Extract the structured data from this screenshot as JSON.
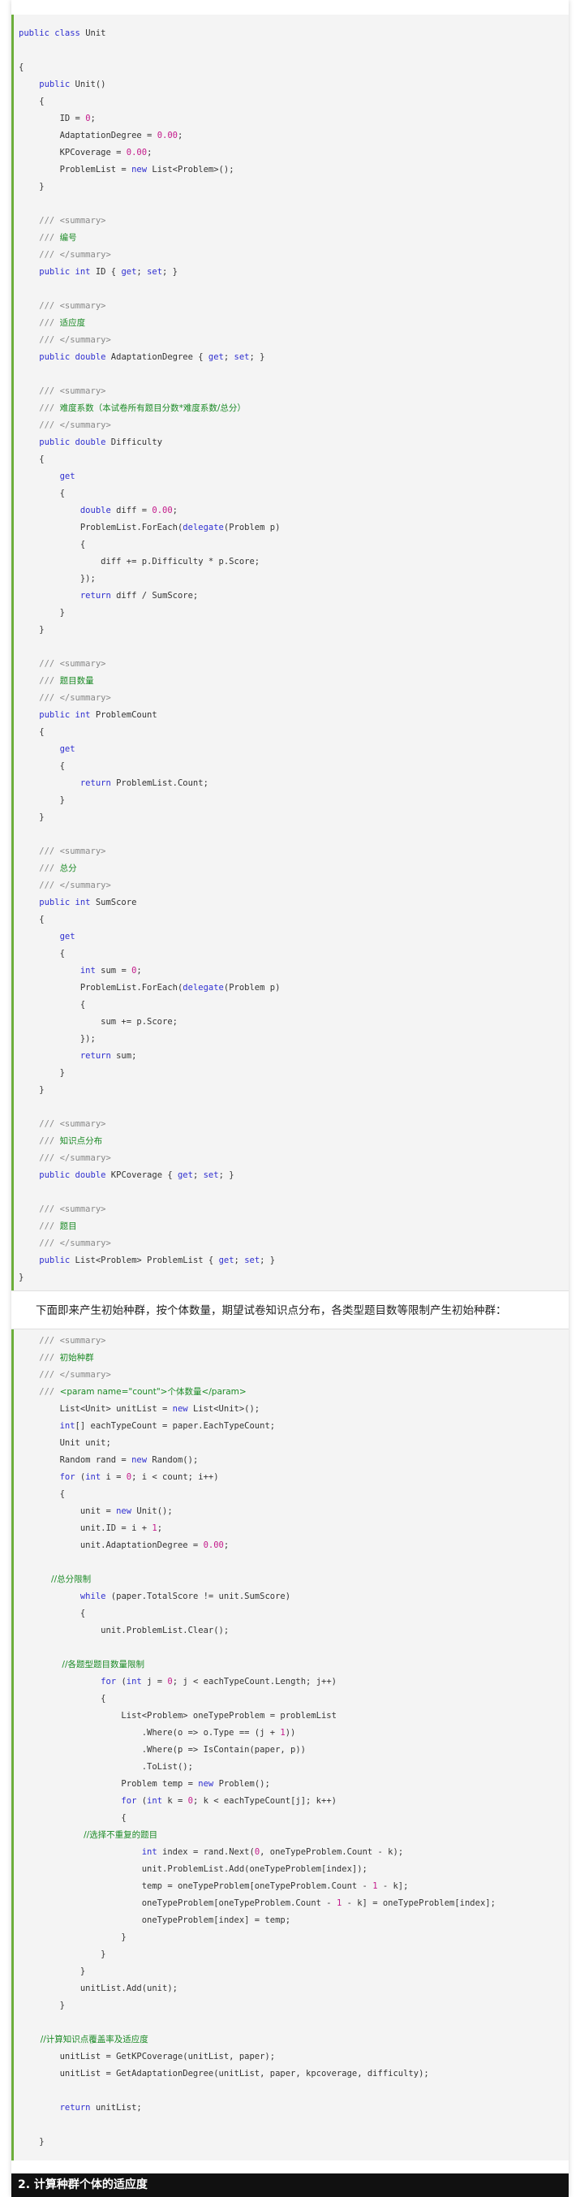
{
  "code_block_1": {
    "lines": [
      [
        {
          "t": "public class ",
          "c": "kw"
        },
        {
          "t": "Unit",
          "c": ""
        }
      ],
      [],
      [
        {
          "t": "{",
          "c": ""
        }
      ],
      [
        {
          "t": "    public ",
          "c": "kw"
        },
        {
          "t": "Unit()",
          "c": ""
        }
      ],
      [
        {
          "t": "    {",
          "c": ""
        }
      ],
      [
        {
          "t": "        ID = ",
          "c": ""
        },
        {
          "t": "0",
          "c": "num"
        },
        {
          "t": ";",
          "c": ""
        }
      ],
      [
        {
          "t": "        AdaptationDegree = ",
          "c": ""
        },
        {
          "t": "0.00",
          "c": "num"
        },
        {
          "t": ";",
          "c": ""
        }
      ],
      [
        {
          "t": "        KPCoverage = ",
          "c": ""
        },
        {
          "t": "0.00",
          "c": "num"
        },
        {
          "t": ";",
          "c": ""
        }
      ],
      [
        {
          "t": "        ProblemList = ",
          "c": ""
        },
        {
          "t": "new ",
          "c": "kw"
        },
        {
          "t": "List<Problem>();",
          "c": ""
        }
      ],
      [
        {
          "t": "    }",
          "c": ""
        }
      ],
      [],
      [
        {
          "t": "    /// <summary>",
          "c": "cm"
        }
      ],
      [
        {
          "t": "    /// ",
          "c": "cm"
        },
        {
          "t": "编号",
          "c": "cmc"
        }
      ],
      [
        {
          "t": "    /// </summary>",
          "c": "cm"
        }
      ],
      [
        {
          "t": "    public int ",
          "c": "kw"
        },
        {
          "t": "ID { ",
          "c": ""
        },
        {
          "t": "get",
          "c": "kw"
        },
        {
          "t": "; ",
          "c": ""
        },
        {
          "t": "set",
          "c": "kw"
        },
        {
          "t": "; }",
          "c": ""
        }
      ],
      [],
      [
        {
          "t": "    /// <summary>",
          "c": "cm"
        }
      ],
      [
        {
          "t": "    /// ",
          "c": "cm"
        },
        {
          "t": "适应度",
          "c": "cmc"
        }
      ],
      [
        {
          "t": "    /// </summary>",
          "c": "cm"
        }
      ],
      [
        {
          "t": "    public double ",
          "c": "kw"
        },
        {
          "t": "AdaptationDegree { ",
          "c": ""
        },
        {
          "t": "get",
          "c": "kw"
        },
        {
          "t": "; ",
          "c": ""
        },
        {
          "t": "set",
          "c": "kw"
        },
        {
          "t": "; }",
          "c": ""
        }
      ],
      [],
      [
        {
          "t": "    /// <summary>",
          "c": "cm"
        }
      ],
      [
        {
          "t": "    /// ",
          "c": "cm"
        },
        {
          "t": "难度系数（本试卷所有题目分数*难度系数/总分）",
          "c": "cmc"
        }
      ],
      [
        {
          "t": "    /// </summary>",
          "c": "cm"
        }
      ],
      [
        {
          "t": "    public double ",
          "c": "kw"
        },
        {
          "t": "Difficulty",
          "c": ""
        }
      ],
      [
        {
          "t": "    {",
          "c": ""
        }
      ],
      [
        {
          "t": "        get",
          "c": "kw"
        }
      ],
      [
        {
          "t": "        {",
          "c": ""
        }
      ],
      [
        {
          "t": "            double ",
          "c": "kw"
        },
        {
          "t": "diff = ",
          "c": ""
        },
        {
          "t": "0.00",
          "c": "num"
        },
        {
          "t": ";",
          "c": ""
        }
      ],
      [
        {
          "t": "            ProblemList.ForEach(",
          "c": ""
        },
        {
          "t": "delegate",
          "c": "kw"
        },
        {
          "t": "(Problem p)",
          "c": ""
        }
      ],
      [
        {
          "t": "            {",
          "c": ""
        }
      ],
      [
        {
          "t": "                diff += p.Difficulty * p.Score;",
          "c": ""
        }
      ],
      [
        {
          "t": "            });",
          "c": ""
        }
      ],
      [
        {
          "t": "            return ",
          "c": "kw"
        },
        {
          "t": "diff / SumScore;",
          "c": ""
        }
      ],
      [
        {
          "t": "        }",
          "c": ""
        }
      ],
      [
        {
          "t": "    }",
          "c": ""
        }
      ],
      [],
      [
        {
          "t": "    /// <summary>",
          "c": "cm"
        }
      ],
      [
        {
          "t": "    /// ",
          "c": "cm"
        },
        {
          "t": "题目数量",
          "c": "cmc"
        }
      ],
      [
        {
          "t": "    /// </summary>",
          "c": "cm"
        }
      ],
      [
        {
          "t": "    public int ",
          "c": "kw"
        },
        {
          "t": "ProblemCount",
          "c": ""
        }
      ],
      [
        {
          "t": "    {",
          "c": ""
        }
      ],
      [
        {
          "t": "        get",
          "c": "kw"
        }
      ],
      [
        {
          "t": "        {",
          "c": ""
        }
      ],
      [
        {
          "t": "            return ",
          "c": "kw"
        },
        {
          "t": "ProblemList.Count;",
          "c": ""
        }
      ],
      [
        {
          "t": "        }",
          "c": ""
        }
      ],
      [
        {
          "t": "    }",
          "c": ""
        }
      ],
      [],
      [
        {
          "t": "    /// <summary>",
          "c": "cm"
        }
      ],
      [
        {
          "t": "    /// ",
          "c": "cm"
        },
        {
          "t": "总分",
          "c": "cmc"
        }
      ],
      [
        {
          "t": "    /// </summary>",
          "c": "cm"
        }
      ],
      [
        {
          "t": "    public int ",
          "c": "kw"
        },
        {
          "t": "SumScore",
          "c": ""
        }
      ],
      [
        {
          "t": "    {",
          "c": ""
        }
      ],
      [
        {
          "t": "        get",
          "c": "kw"
        }
      ],
      [
        {
          "t": "        {",
          "c": ""
        }
      ],
      [
        {
          "t": "            int ",
          "c": "kw"
        },
        {
          "t": "sum = ",
          "c": ""
        },
        {
          "t": "0",
          "c": "num"
        },
        {
          "t": ";",
          "c": ""
        }
      ],
      [
        {
          "t": "            ProblemList.ForEach(",
          "c": ""
        },
        {
          "t": "delegate",
          "c": "kw"
        },
        {
          "t": "(Problem p)",
          "c": ""
        }
      ],
      [
        {
          "t": "            {",
          "c": ""
        }
      ],
      [
        {
          "t": "                sum += p.Score;",
          "c": ""
        }
      ],
      [
        {
          "t": "            });",
          "c": ""
        }
      ],
      [
        {
          "t": "            return ",
          "c": "kw"
        },
        {
          "t": "sum;",
          "c": ""
        }
      ],
      [
        {
          "t": "        }",
          "c": ""
        }
      ],
      [
        {
          "t": "    }",
          "c": ""
        }
      ],
      [],
      [
        {
          "t": "    /// <summary>",
          "c": "cm"
        }
      ],
      [
        {
          "t": "    /// ",
          "c": "cm"
        },
        {
          "t": "知识点分布",
          "c": "cmc"
        }
      ],
      [
        {
          "t": "    /// </summary>",
          "c": "cm"
        }
      ],
      [
        {
          "t": "    public double ",
          "c": "kw"
        },
        {
          "t": "KPCoverage { ",
          "c": ""
        },
        {
          "t": "get",
          "c": "kw"
        },
        {
          "t": "; ",
          "c": ""
        },
        {
          "t": "set",
          "c": "kw"
        },
        {
          "t": "; }",
          "c": ""
        }
      ],
      [],
      [
        {
          "t": "    /// <summary>",
          "c": "cm"
        }
      ],
      [
        {
          "t": "    /// ",
          "c": "cm"
        },
        {
          "t": "题目",
          "c": "cmc"
        }
      ],
      [
        {
          "t": "    /// </summary>",
          "c": "cm"
        }
      ],
      [
        {
          "t": "    public ",
          "c": "kw"
        },
        {
          "t": "List<Problem> ProblemList { ",
          "c": ""
        },
        {
          "t": "get",
          "c": "kw"
        },
        {
          "t": "; ",
          "c": ""
        },
        {
          "t": "set",
          "c": "kw"
        },
        {
          "t": "; }",
          "c": ""
        }
      ],
      [
        {
          "t": "}",
          "c": ""
        }
      ]
    ]
  },
  "paragraph": "下面即来产生初始种群，按个体数量，期望试卷知识点分布，各类型题目数等限制产生初始种群：",
  "code_block_2": {
    "lines": [
      [
        {
          "t": "    /// <summary>",
          "c": "cm"
        }
      ],
      [
        {
          "t": "    /// ",
          "c": "cm"
        },
        {
          "t": "初始种群",
          "c": "cmc"
        }
      ],
      [
        {
          "t": "    /// </summary>",
          "c": "cm"
        }
      ],
      [
        {
          "t": "    /// ",
          "c": "cm"
        },
        {
          "t": "<param name=\"count\">个体数量</param>",
          "c": "cmc"
        }
      ],
      [
        {
          "t": "        List<Unit> unitList = ",
          "c": ""
        },
        {
          "t": "new ",
          "c": "kw"
        },
        {
          "t": "List<Unit>();",
          "c": ""
        }
      ],
      [
        {
          "t": "        int",
          "c": "kw"
        },
        {
          "t": "[] eachTypeCount = paper.EachTypeCount;",
          "c": ""
        }
      ],
      [
        {
          "t": "        Unit unit;",
          "c": ""
        }
      ],
      [
        {
          "t": "        Random rand = ",
          "c": ""
        },
        {
          "t": "new ",
          "c": "kw"
        },
        {
          "t": "Random();",
          "c": ""
        }
      ],
      [
        {
          "t": "        for ",
          "c": "kw"
        },
        {
          "t": "(",
          "c": ""
        },
        {
          "t": "int ",
          "c": "kw"
        },
        {
          "t": "i = ",
          "c": ""
        },
        {
          "t": "0",
          "c": "num"
        },
        {
          "t": "; i < count; i++)",
          "c": ""
        }
      ],
      [
        {
          "t": "        {",
          "c": ""
        }
      ],
      [
        {
          "t": "            unit = ",
          "c": ""
        },
        {
          "t": "new ",
          "c": "kw"
        },
        {
          "t": "Unit();",
          "c": ""
        }
      ],
      [
        {
          "t": "            unit.ID = i + ",
          "c": ""
        },
        {
          "t": "1",
          "c": "num"
        },
        {
          "t": ";",
          "c": ""
        }
      ],
      [
        {
          "t": "            unit.AdaptationDegree = ",
          "c": ""
        },
        {
          "t": "0.00",
          "c": "num"
        },
        {
          "t": ";",
          "c": ""
        }
      ],
      [],
      [
        {
          "t": "            //总分限制",
          "c": "cmc"
        }
      ],
      [
        {
          "t": "            while ",
          "c": "kw"
        },
        {
          "t": "(paper.TotalScore != unit.SumScore)",
          "c": ""
        }
      ],
      [
        {
          "t": "            {",
          "c": ""
        }
      ],
      [
        {
          "t": "                unit.ProblemList.Clear();",
          "c": ""
        }
      ],
      [],
      [
        {
          "t": "                //各题型题目数量限制",
          "c": "cmc"
        }
      ],
      [
        {
          "t": "                for ",
          "c": "kw"
        },
        {
          "t": "(",
          "c": ""
        },
        {
          "t": "int ",
          "c": "kw"
        },
        {
          "t": "j = ",
          "c": ""
        },
        {
          "t": "0",
          "c": "num"
        },
        {
          "t": "; j < eachTypeCount.Length; j++)",
          "c": ""
        }
      ],
      [
        {
          "t": "                {",
          "c": ""
        }
      ],
      [
        {
          "t": "                    List<Problem> oneTypeProblem = problemList",
          "c": ""
        }
      ],
      [
        {
          "t": "                        .Where(o => o.Type == (j + ",
          "c": ""
        },
        {
          "t": "1",
          "c": "num"
        },
        {
          "t": "))",
          "c": ""
        }
      ],
      [
        {
          "t": "                        .Where(p => IsContain(paper, p))",
          "c": ""
        }
      ],
      [
        {
          "t": "                        .ToList();",
          "c": ""
        }
      ],
      [
        {
          "t": "                    Problem temp = ",
          "c": ""
        },
        {
          "t": "new ",
          "c": "kw"
        },
        {
          "t": "Problem();",
          "c": ""
        }
      ],
      [
        {
          "t": "                    for ",
          "c": "kw"
        },
        {
          "t": "(",
          "c": ""
        },
        {
          "t": "int ",
          "c": "kw"
        },
        {
          "t": "k = ",
          "c": ""
        },
        {
          "t": "0",
          "c": "num"
        },
        {
          "t": "; k < eachTypeCount[j]; k++)",
          "c": ""
        }
      ],
      [
        {
          "t": "                    {",
          "c": ""
        }
      ],
      [
        {
          "t": "                        //选择不重复的题目",
          "c": "cmc"
        }
      ],
      [
        {
          "t": "                        int ",
          "c": "kw"
        },
        {
          "t": "index = rand.Next(",
          "c": ""
        },
        {
          "t": "0",
          "c": "num"
        },
        {
          "t": ", oneTypeProblem.Count - k);",
          "c": ""
        }
      ],
      [
        {
          "t": "                        unit.ProblemList.Add(oneTypeProblem[index]);",
          "c": ""
        }
      ],
      [
        {
          "t": "                        temp = oneTypeProblem[oneTypeProblem.Count - ",
          "c": ""
        },
        {
          "t": "1",
          "c": "num"
        },
        {
          "t": " - k];",
          "c": ""
        }
      ],
      [
        {
          "t": "                        oneTypeProblem[oneTypeProblem.Count - ",
          "c": ""
        },
        {
          "t": "1",
          "c": "num"
        },
        {
          "t": " - k] = oneTypeProblem[index];",
          "c": ""
        }
      ],
      [
        {
          "t": "                        oneTypeProblem[index] = temp;",
          "c": ""
        }
      ],
      [
        {
          "t": "                    }",
          "c": ""
        }
      ],
      [
        {
          "t": "                }",
          "c": ""
        }
      ],
      [
        {
          "t": "            }",
          "c": ""
        }
      ],
      [
        {
          "t": "            unitList.Add(unit);",
          "c": ""
        }
      ],
      [
        {
          "t": "        }",
          "c": ""
        }
      ],
      [],
      [
        {
          "t": "        //计算知识点覆盖率及适应度",
          "c": "cmc"
        }
      ],
      [
        {
          "t": "        unitList = GetKPCoverage(unitList, paper);",
          "c": ""
        }
      ],
      [
        {
          "t": "        unitList = GetAdaptationDegree(unitList, paper, kpcoverage, difficulty);",
          "c": ""
        }
      ],
      [],
      [
        {
          "t": "        return ",
          "c": "kw"
        },
        {
          "t": "unitList;",
          "c": ""
        }
      ],
      [],
      [
        {
          "t": "    }",
          "c": ""
        }
      ]
    ]
  },
  "section_heading": "2. 计算种群个体的适应度"
}
